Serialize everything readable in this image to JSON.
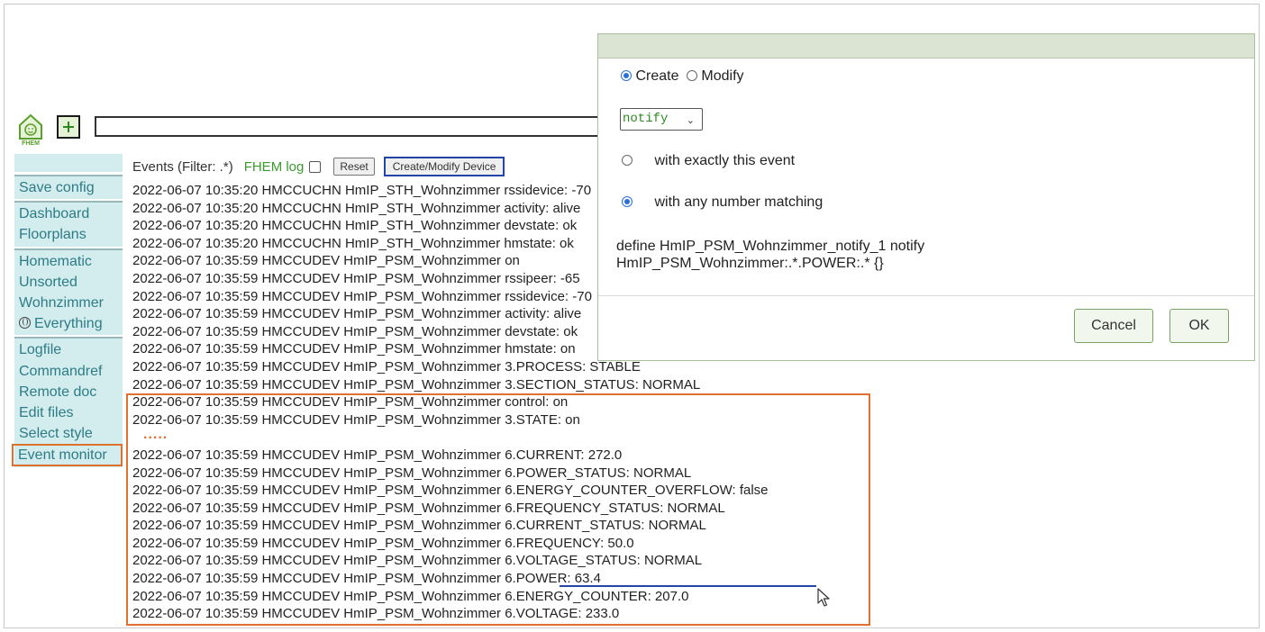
{
  "logo": {
    "label": "FHEM"
  },
  "command_input": {
    "value": ""
  },
  "menu": {
    "groups": [
      {
        "items": [
          {
            "label": "Save config"
          }
        ]
      },
      {
        "items": [
          {
            "label": "Dashboard"
          },
          {
            "label": "Floorplans"
          }
        ]
      },
      {
        "items": [
          {
            "label": "Homematic"
          },
          {
            "label": "Unsorted"
          },
          {
            "label": "Wohnzimmer"
          },
          {
            "label": "Everything"
          }
        ]
      },
      {
        "items": [
          {
            "label": "Logfile"
          },
          {
            "label": "Commandref"
          },
          {
            "label": "Remote doc"
          },
          {
            "label": "Edit files"
          },
          {
            "label": "Select style"
          },
          {
            "label": "Event monitor"
          }
        ]
      }
    ]
  },
  "toolbar": {
    "events_label": "Events (Filter: .*)",
    "fhem_log_label": "FHEM log",
    "fhem_log_checked": false,
    "reset_label": "Reset",
    "create_modify_label": "Create/Modify Device"
  },
  "events": [
    "2022-06-07 10:35:20 HMCCUCHN HmIP_STH_Wohnzimmer rssidevice: -70",
    "2022-06-07 10:35:20 HMCCUCHN HmIP_STH_Wohnzimmer activity: alive",
    "2022-06-07 10:35:20 HMCCUCHN HmIP_STH_Wohnzimmer devstate: ok",
    "2022-06-07 10:35:20 HMCCUCHN HmIP_STH_Wohnzimmer hmstate: ok",
    "2022-06-07 10:35:59 HMCCUDEV HmIP_PSM_Wohnzimmer on",
    "2022-06-07 10:35:59 HMCCUDEV HmIP_PSM_Wohnzimmer rssipeer: -65",
    "2022-06-07 10:35:59 HMCCUDEV HmIP_PSM_Wohnzimmer rssidevice: -70",
    "2022-06-07 10:35:59 HMCCUDEV HmIP_PSM_Wohnzimmer activity: alive",
    "2022-06-07 10:35:59 HMCCUDEV HmIP_PSM_Wohnzimmer devstate: ok",
    "2022-06-07 10:35:59 HMCCUDEV HmIP_PSM_Wohnzimmer hmstate: on",
    "2022-06-07 10:35:59 HMCCUDEV HmIP_PSM_Wohnzimmer 3.PROCESS: STABLE",
    "2022-06-07 10:35:59 HMCCUDEV HmIP_PSM_Wohnzimmer 3.SECTION_STATUS: NORMAL",
    "2022-06-07 10:35:59 HMCCUDEV HmIP_PSM_Wohnzimmer control: on",
    "2022-06-07 10:35:59 HMCCUDEV HmIP_PSM_Wohnzimmer 3.STATE: on"
  ],
  "ellipsis": ".....",
  "events_after": [
    "2022-06-07 10:35:59 HMCCUDEV HmIP_PSM_Wohnzimmer 6.CURRENT: 272.0",
    "2022-06-07 10:35:59 HMCCUDEV HmIP_PSM_Wohnzimmer 6.POWER_STATUS: NORMAL",
    "2022-06-07 10:35:59 HMCCUDEV HmIP_PSM_Wohnzimmer 6.ENERGY_COUNTER_OVERFLOW: false",
    "2022-06-07 10:35:59 HMCCUDEV HmIP_PSM_Wohnzimmer 6.FREQUENCY_STATUS: NORMAL",
    "2022-06-07 10:35:59 HMCCUDEV HmIP_PSM_Wohnzimmer 6.CURRENT_STATUS: NORMAL",
    "2022-06-07 10:35:59 HMCCUDEV HmIP_PSM_Wohnzimmer 6.FREQUENCY: 50.0",
    "2022-06-07 10:35:59 HMCCUDEV HmIP_PSM_Wohnzimmer 6.VOLTAGE_STATUS: NORMAL",
    "2022-06-07 10:35:59 HMCCUDEV HmIP_PSM_Wohnzimmer 6.POWER: 63.4",
    "2022-06-07 10:35:59 HMCCUDEV HmIP_PSM_Wohnzimmer 6.ENERGY_COUNTER: 207.0",
    "2022-06-07 10:35:59 HMCCUDEV HmIP_PSM_Wohnzimmer 6.VOLTAGE: 233.0"
  ],
  "dialog": {
    "create_label": "Create",
    "modify_label": "Modify",
    "mode_selected": "create",
    "type_select": {
      "value": "notify"
    },
    "option_exact_label": "with exactly this event",
    "option_any_label": "with any number matching",
    "option_selected": "any",
    "define_line1": "define HmIP_PSM_Wohnzimmer_notify_1 notify",
    "define_line2": "HmIP_PSM_Wohnzimmer:.*.POWER:.* {}",
    "cancel_label": "Cancel",
    "ok_label": "OK"
  },
  "colors": {
    "menu_background": "#d3ecee",
    "menu_text": "#2d7c86",
    "highlight_orange": "#e0702e",
    "highlight_blue": "#2345a6",
    "fhem_green": "#3b9b2f"
  }
}
